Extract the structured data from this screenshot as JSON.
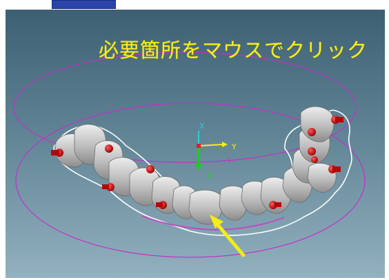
{
  "header": {
    "tab_label": ""
  },
  "viewport": {
    "instruction": "必要箇所をマウスでクリック",
    "axes": {
      "x_label": "X",
      "y_label": "Y",
      "z_label": "Z"
    },
    "colors": {
      "background_top": "#3d5f72",
      "background_bottom": "#93b1bf",
      "instruction_text": "#f6ee1a",
      "guide_ring": "#c032c8",
      "margin_outline": "#ffffff",
      "attachment": "#d01010",
      "pointer_arrow": "#f3ee12",
      "tooth": "#c9c9c9"
    },
    "pointer": {
      "icon": "arrow-icon",
      "target": "tooth-front-center"
    }
  }
}
